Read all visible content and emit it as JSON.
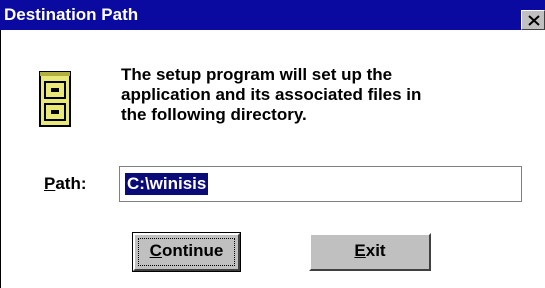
{
  "window": {
    "title": "Destination Path"
  },
  "message": {
    "lines": [
      "The setup program will set up the",
      "application and its associated files in",
      "the following directory."
    ]
  },
  "path": {
    "label_mnemonic": "P",
    "label_rest": "ath:",
    "value": "C:\\winisis"
  },
  "buttons": {
    "continue_mnemonic": "C",
    "continue_rest": "ontinue",
    "exit_mnemonic": "E",
    "exit_rest": "xit"
  },
  "icons": {
    "title_close": "close-icon",
    "dialog_icon": "file-cabinet-icon"
  },
  "colors": {
    "titlebar": "#0a0aa0",
    "selection": "#0a0a78",
    "button_face": "#c0c0c0",
    "cabinet": "#e8e878"
  }
}
